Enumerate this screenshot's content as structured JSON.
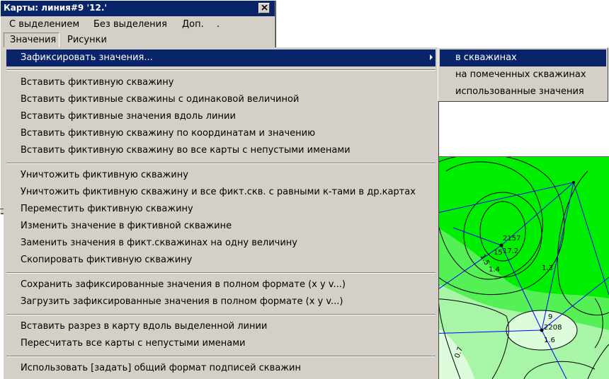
{
  "window": {
    "title": "Карты: линия#9 '12.'",
    "close_glyph": "×"
  },
  "menubar_top": {
    "items": [
      "С выделением",
      "Без выделения",
      "Доп.",
      "."
    ]
  },
  "menubar_bottom": {
    "items": [
      "Значения",
      "Рисунки"
    ]
  },
  "dropdown": {
    "groups": [
      [
        "Зафиксировать значения..."
      ],
      [
        "Вставить фиктивную скважину",
        "Вставить фиктивные скважины с одинаковой величиной",
        "Вставить фиктивные значения вдоль линии",
        "Вставить фиктивную скважину по координатам и значению",
        "Вставить фиктивную скважину во все карты с непустыми именами"
      ],
      [
        "Уничтожить фиктивную скважину",
        "Уничтожить фиктивную скважину и все фикт.скв. с равными к-тами в др.картах",
        "Переместить фиктивную скважину",
        "Изменить значение в фиктивной скважине",
        "Заменить значения в фикт.скважинах на одну величину",
        "Скопировать фиктивную скважину"
      ],
      [
        "Сохранить зафиксированные значения в полном формате (x y v...)",
        "Загрузить зафиксированные значения в полном формате (x y v...)"
      ],
      [
        "Вставить разрез в карту вдоль выделенной линии",
        "Пересчитать все карты с непустыми именами"
      ],
      [
        "Использовать [задать] общий формат подписей скважин"
      ]
    ]
  },
  "submenu": {
    "items": [
      "в скважинах",
      "на помеченных скважинах",
      "использованные значения"
    ]
  },
  "map": {
    "labels": [
      "2157",
      "1.5",
      "15",
      "17.2",
      "1.4",
      "1.3",
      "9",
      "2208",
      "1.6",
      "0.7"
    ]
  },
  "colors": {
    "highlight": "#0a246a",
    "face": "#d4d0c8",
    "map_green_dark": "#00ee00",
    "map_green_mid": "#55f055",
    "map_green_light": "#a8f5a8",
    "map_green_pale": "#dcfcdc",
    "map_lines": "#0000ff"
  }
}
